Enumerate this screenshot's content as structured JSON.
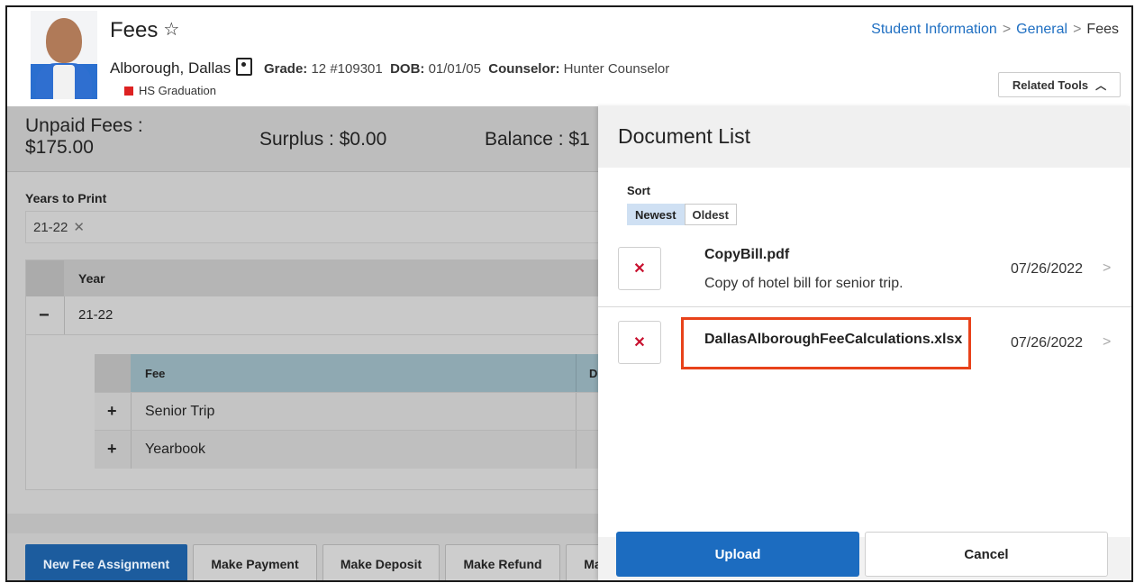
{
  "header": {
    "page_title": "Fees",
    "student_name": "Alborough, Dallas",
    "grade_label": "Grade:",
    "grade_value": "12 #109301",
    "dob_label": "DOB:",
    "dob_value": "01/01/05",
    "counselor_label": "Counselor:",
    "counselor_value": "Hunter Counselor",
    "graduation_program": "HS Graduation",
    "breadcrumb": [
      "Student Information",
      "General",
      "Fees"
    ],
    "related_tools_label": "Related Tools"
  },
  "summary": {
    "unpaid_label": "Unpaid Fees :",
    "unpaid_value": "$175.00",
    "surplus": "Surplus : $0.00",
    "balance": "Balance : $1"
  },
  "years_to_print": {
    "label": "Years to Print",
    "selected": [
      "21-22"
    ]
  },
  "year_table": {
    "header": "Year",
    "rows": [
      {
        "year": "21-22",
        "expanded": true
      }
    ]
  },
  "fee_table": {
    "headers": [
      "Fee",
      "D"
    ],
    "rows": [
      "Senior Trip",
      "Yearbook"
    ]
  },
  "actions": [
    "New Fee Assignment",
    "Make Payment",
    "Make Deposit",
    "Make Refund",
    "Ma"
  ],
  "document_panel": {
    "title": "Document List",
    "sort_label": "Sort",
    "sort_options": [
      "Newest",
      "Oldest"
    ],
    "sort_selected": "Newest",
    "documents": [
      {
        "name": "CopyBill.pdf",
        "description": "Copy of hotel bill for senior trip.",
        "date": "07/26/2022"
      },
      {
        "name": "DallasAlboroughFeeCalculations.xlsx",
        "description": "",
        "date": "07/26/2022",
        "highlighted": true
      }
    ],
    "upload_label": "Upload",
    "cancel_label": "Cancel"
  },
  "colors": {
    "accent": "#1c6cc0",
    "highlight": "#e8421a",
    "delete": "#c8102e",
    "overlay": "#c7c7c7"
  },
  "icons": [
    "star-icon",
    "contact-card-icon",
    "graduation-icon",
    "chevron-up-icon",
    "close-icon",
    "minus-icon",
    "plus-icon",
    "chevron-right-icon"
  ]
}
